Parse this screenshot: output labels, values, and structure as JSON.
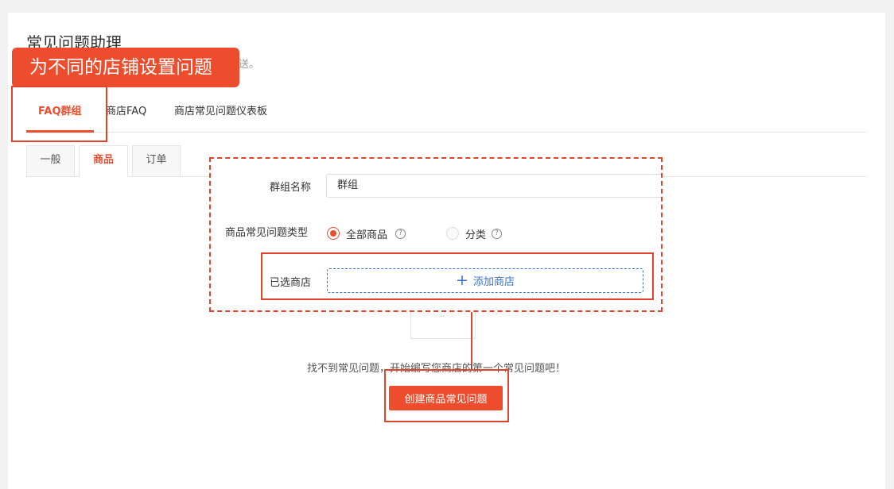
{
  "page": {
    "title": "常见问题助理",
    "subtitle_visible_tail": "送。"
  },
  "callout": {
    "text": "为不同的店铺设置问题"
  },
  "main_tabs": [
    {
      "label": "FAQ群组",
      "active": true
    },
    {
      "label": "商店FAQ",
      "active": false
    },
    {
      "label": "商店常见问题仪表板",
      "active": false
    }
  ],
  "sub_tabs": [
    {
      "label": "一般",
      "active": false
    },
    {
      "label": "商品",
      "active": true
    },
    {
      "label": "订单",
      "active": false
    }
  ],
  "form": {
    "group_name": {
      "label": "群组名称",
      "value": "群组"
    },
    "faq_type": {
      "label": "商品常见问题类型",
      "options": [
        {
          "label": "全部商品",
          "selected": true,
          "help_icon": "question-circle-icon"
        },
        {
          "label": "分类",
          "selected": false,
          "help_icon": "question-circle-icon"
        }
      ]
    },
    "selected_shops": {
      "label": "已选商店",
      "add_button": "添加商店",
      "add_icon": "plus-icon"
    }
  },
  "empty_state": {
    "text": "找不到常见问题，开始编写您商店的第一个常见问题吧！",
    "create_button": "创建商品常见问题"
  },
  "colors": {
    "accent": "#ee4d2d",
    "annotation": "#e0452a",
    "link_blue": "#3c74c8",
    "page_bg": "#f2f2f2"
  }
}
